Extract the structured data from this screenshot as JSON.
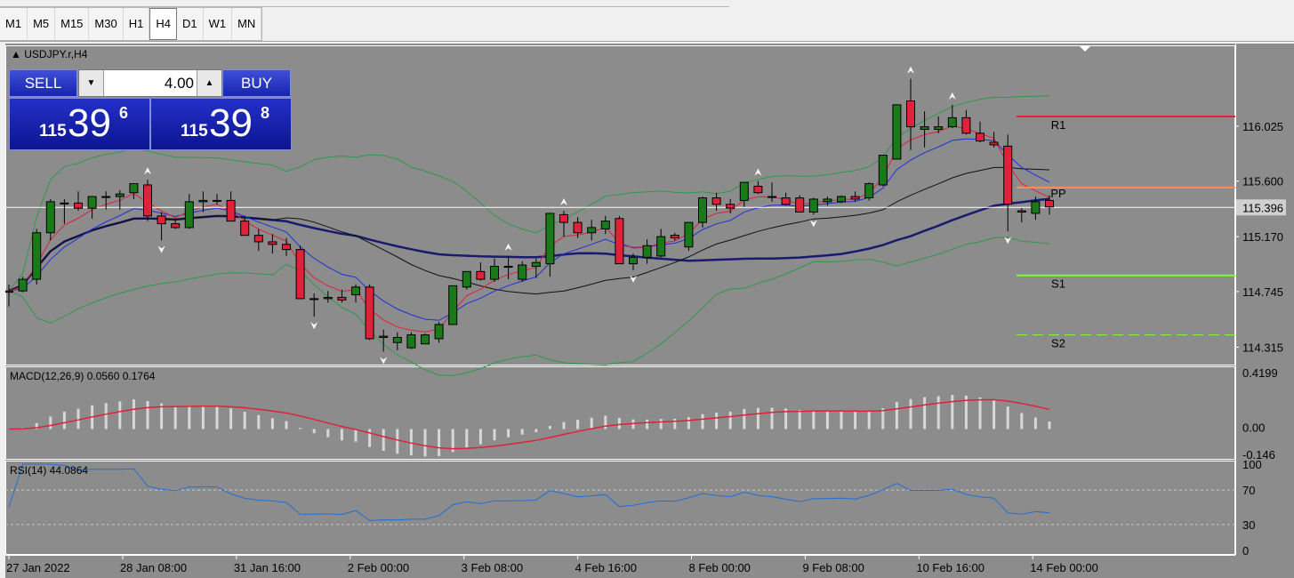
{
  "timeframes": [
    {
      "label": "M1",
      "active": false
    },
    {
      "label": "M5",
      "active": false
    },
    {
      "label": "M15",
      "active": false
    },
    {
      "label": "M30",
      "active": false
    },
    {
      "label": "H1",
      "active": false
    },
    {
      "label": "H4",
      "active": true
    },
    {
      "label": "D1",
      "active": false
    },
    {
      "label": "W1",
      "active": false
    },
    {
      "label": "MN",
      "active": false
    }
  ],
  "chart": {
    "symbol_title": "USDJPY.r,H4",
    "current_price_label": "115.396",
    "price_axis_labels": [
      "116.025",
      "115.600",
      "115.170",
      "114.745",
      "114.315"
    ],
    "time_axis_labels": [
      "27 Jan 2022",
      "28 Jan 08:00",
      "31 Jan 16:00",
      "2 Feb 00:00",
      "3 Feb 08:00",
      "4 Feb 16:00",
      "8 Feb 00:00",
      "9 Feb 08:00",
      "10 Feb 16:00",
      "14 Feb 00:00"
    ],
    "pivot_labels": {
      "r1": "R1",
      "pp": "PP",
      "s1": "S1",
      "s2": "S2"
    },
    "colors": {
      "background": "#8c8c8c",
      "bull": "#1a7a1a",
      "bear": "#e0213a",
      "r1": "#e0213a",
      "pp": "#ff8c5a",
      "s1": "#7dff2a",
      "s2": "#7dff2a"
    }
  },
  "trade_panel": {
    "sell_label": "SELL",
    "buy_label": "BUY",
    "lot_value": "4.00",
    "bid": {
      "prefix": "115",
      "big": "39",
      "sup": "6"
    },
    "ask": {
      "prefix": "115",
      "big": "39",
      "sup": "8"
    }
  },
  "macd": {
    "title": "MACD(12,26,9) 0.0560 0.1764",
    "axis_labels": [
      "0.4199",
      "0.00",
      "-0.146"
    ]
  },
  "rsi": {
    "title": "RSI(14) 44.0864",
    "axis_labels": [
      "100",
      "70",
      "30",
      "0"
    ]
  },
  "chart_data": {
    "type": "candlestick",
    "series": [
      {
        "name": "USDJPY.r,H4",
        "ohlc": [
          [
            114.74,
            114.8,
            114.63,
            114.75
          ],
          [
            114.75,
            114.86,
            114.74,
            114.84
          ],
          [
            114.84,
            115.23,
            114.8,
            115.2
          ],
          [
            115.2,
            115.46,
            115.14,
            115.44
          ],
          [
            115.43,
            115.46,
            115.27,
            115.43
          ],
          [
            115.43,
            115.52,
            115.37,
            115.39
          ],
          [
            115.39,
            115.46,
            115.31,
            115.48
          ],
          [
            115.48,
            115.52,
            115.38,
            115.48
          ],
          [
            115.48,
            115.53,
            115.38,
            115.5
          ],
          [
            115.51,
            115.58,
            115.46,
            115.58
          ],
          [
            115.57,
            115.61,
            115.29,
            115.33
          ],
          [
            115.33,
            115.36,
            115.14,
            115.27
          ],
          [
            115.27,
            115.31,
            115.23,
            115.24
          ],
          [
            115.24,
            115.5,
            115.23,
            115.44
          ],
          [
            115.44,
            115.52,
            115.36,
            115.45
          ],
          [
            115.45,
            115.5,
            115.42,
            115.45
          ],
          [
            115.45,
            115.52,
            115.4,
            115.29
          ],
          [
            115.29,
            115.33,
            115.2,
            115.18
          ],
          [
            115.18,
            115.23,
            115.06,
            115.13
          ],
          [
            115.13,
            115.19,
            115.04,
            115.11
          ],
          [
            115.11,
            115.16,
            115.02,
            115.07
          ],
          [
            115.07,
            115.1,
            114.7,
            114.69
          ],
          [
            114.69,
            114.73,
            114.55,
            114.69
          ],
          [
            114.69,
            114.75,
            114.66,
            114.7
          ],
          [
            114.7,
            114.76,
            114.66,
            114.68
          ],
          [
            114.72,
            114.8,
            114.66,
            114.78
          ],
          [
            114.78,
            114.8,
            114.37,
            114.38
          ],
          [
            114.39,
            114.45,
            114.28,
            114.4
          ],
          [
            114.35,
            114.43,
            114.29,
            114.39
          ],
          [
            114.31,
            114.43,
            114.3,
            114.41
          ],
          [
            114.34,
            114.42,
            114.34,
            114.41
          ],
          [
            114.38,
            114.51,
            114.35,
            114.49
          ],
          [
            114.49,
            114.79,
            114.49,
            114.79
          ],
          [
            114.78,
            114.9,
            114.76,
            114.9
          ],
          [
            114.9,
            114.97,
            114.83,
            114.84
          ],
          [
            114.84,
            115.0,
            114.82,
            114.94
          ],
          [
            114.94,
            115.02,
            114.84,
            114.94
          ],
          [
            114.84,
            114.98,
            114.82,
            114.95
          ],
          [
            114.94,
            115.0,
            114.85,
            114.97
          ],
          [
            114.96,
            115.35,
            114.86,
            115.35
          ],
          [
            115.34,
            115.37,
            115.17,
            115.28
          ],
          [
            115.28,
            115.32,
            115.16,
            115.2
          ],
          [
            115.2,
            115.3,
            115.14,
            115.24
          ],
          [
            115.23,
            115.33,
            115.19,
            115.29
          ],
          [
            115.31,
            115.33,
            114.98,
            114.96
          ],
          [
            114.96,
            115.04,
            114.91,
            115.01
          ],
          [
            115.01,
            115.15,
            114.96,
            115.1
          ],
          [
            115.02,
            115.23,
            115.01,
            115.17
          ],
          [
            115.18,
            115.2,
            115.14,
            115.16
          ],
          [
            115.09,
            115.28,
            115.06,
            115.28
          ],
          [
            115.28,
            115.48,
            115.24,
            115.47
          ],
          [
            115.47,
            115.51,
            115.37,
            115.42
          ],
          [
            115.42,
            115.46,
            115.35,
            115.39
          ],
          [
            115.45,
            115.59,
            115.4,
            115.59
          ],
          [
            115.56,
            115.6,
            115.5,
            115.51
          ],
          [
            115.48,
            115.59,
            115.44,
            115.48
          ],
          [
            115.47,
            115.51,
            115.41,
            115.42
          ],
          [
            115.47,
            115.49,
            115.36,
            115.36
          ],
          [
            115.36,
            115.47,
            115.34,
            115.46
          ],
          [
            115.44,
            115.48,
            115.41,
            115.46
          ],
          [
            115.44,
            115.49,
            115.43,
            115.48
          ],
          [
            115.48,
            115.52,
            115.44,
            115.46
          ],
          [
            115.47,
            115.59,
            115.45,
            115.58
          ],
          [
            115.57,
            115.8,
            115.56,
            115.8
          ],
          [
            115.77,
            116.19,
            115.77,
            116.19
          ],
          [
            116.22,
            116.39,
            115.84,
            116.02
          ],
          [
            116.0,
            116.14,
            115.86,
            116.02
          ],
          [
            116.0,
            116.1,
            115.97,
            116.02
          ],
          [
            116.02,
            116.19,
            116.01,
            116.09
          ],
          [
            116.09,
            116.15,
            115.96,
            115.97
          ],
          [
            115.97,
            116.06,
            115.9,
            115.91
          ],
          [
            115.9,
            115.98,
            115.86,
            115.88
          ],
          [
            115.87,
            115.96,
            115.21,
            115.42
          ],
          [
            115.37,
            115.39,
            115.28,
            115.36
          ],
          [
            115.35,
            115.48,
            115.3,
            115.44
          ],
          [
            115.45,
            115.49,
            115.34,
            115.4
          ]
        ]
      }
    ],
    "x_labels": [
      "27 Jan 2022",
      "28 Jan 08:00",
      "31 Jan 16:00",
      "2 Feb 00:00",
      "3 Feb 08:00",
      "4 Feb 16:00",
      "8 Feb 00:00",
      "9 Feb 08:00",
      "10 Feb 16:00",
      "14 Feb 00:00"
    ],
    "pivots": {
      "R1": 116.1,
      "PP": 115.55,
      "S1": 114.87,
      "S2": 114.41
    },
    "ylim": [
      114.18,
      116.65
    ],
    "macd": {
      "ylim": [
        -0.19,
        0.42
      ],
      "line": 0.056,
      "signal": 0.1764
    },
    "rsi": {
      "value": 44.0864,
      "levels": [
        70,
        30
      ]
    }
  }
}
